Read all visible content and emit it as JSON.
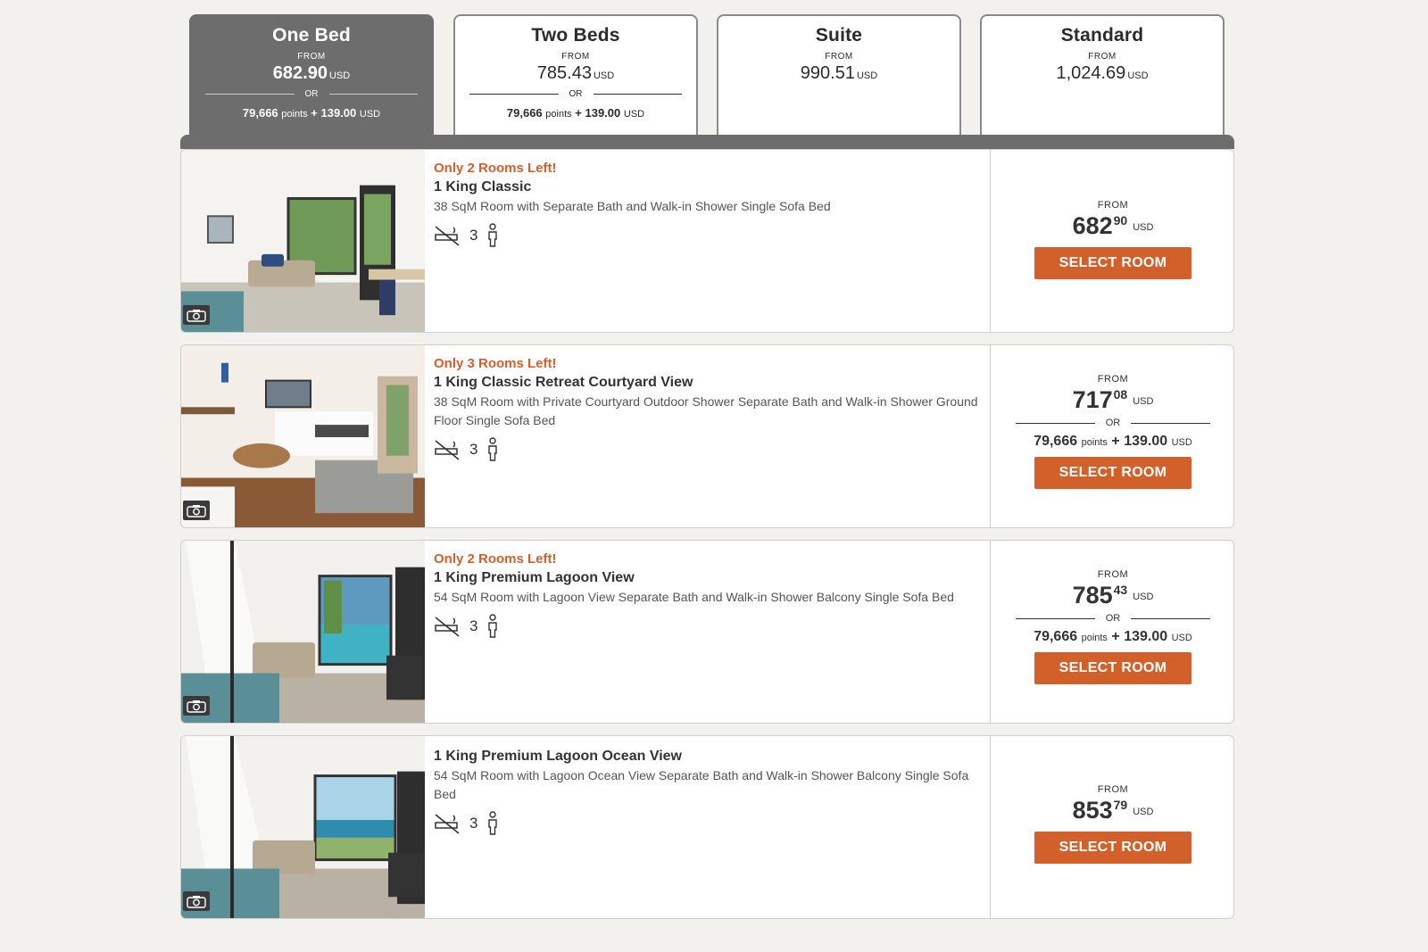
{
  "tabs": [
    {
      "name": "One Bed",
      "from": "FROM",
      "price": "682.90",
      "currency": "USD",
      "or": "OR",
      "points": "79,666",
      "points_word": "points",
      "plus": "+",
      "cash": "139.00",
      "cash_currency": "USD",
      "active": true
    },
    {
      "name": "Two Beds",
      "from": "FROM",
      "price": "785.43",
      "currency": "USD",
      "or": "OR",
      "points": "79,666",
      "points_word": "points",
      "plus": "+",
      "cash": "139.00",
      "cash_currency": "USD",
      "active": false
    },
    {
      "name": "Suite",
      "from": "FROM",
      "price": "990.51",
      "currency": "USD",
      "active": false
    },
    {
      "name": "Standard",
      "from": "FROM",
      "price": "1,024.69",
      "currency": "USD",
      "active": false
    }
  ],
  "rooms": [
    {
      "badge": "Only 2 Rooms Left!",
      "name": "1 King Classic",
      "description": "38 SqM Room with Separate Bath and Walk-in Shower Single Sofa Bed",
      "occupancy": "3",
      "from": "FROM",
      "price_whole": "682",
      "price_cents": "90",
      "currency": "USD",
      "button": "SELECT ROOM"
    },
    {
      "badge": "Only 3 Rooms Left!",
      "name": "1 King Classic Retreat Courtyard View",
      "description": "38 SqM Room with Private Courtyard Outdoor Shower Separate Bath and Walk-in Shower Ground Floor Single Sofa Bed",
      "occupancy": "3",
      "from": "FROM",
      "price_whole": "717",
      "price_cents": "08",
      "currency": "USD",
      "or": "OR",
      "points": "79,666",
      "points_word": "points",
      "plus": "+",
      "cash": "139.00",
      "cash_currency": "USD",
      "button": "SELECT ROOM"
    },
    {
      "badge": "Only 2 Rooms Left!",
      "name": "1 King Premium Lagoon View",
      "description": "54 SqM Room with Lagoon View Separate Bath and Walk-in Shower Balcony Single Sofa Bed",
      "occupancy": "3",
      "from": "FROM",
      "price_whole": "785",
      "price_cents": "43",
      "currency": "USD",
      "or": "OR",
      "points": "79,666",
      "points_word": "points",
      "plus": "+",
      "cash": "139.00",
      "cash_currency": "USD",
      "button": "SELECT ROOM"
    },
    {
      "name": "1 King Premium Lagoon Ocean View",
      "description": "54 SqM Room with Lagoon Ocean View Separate Bath and Walk-in Shower Balcony Single Sofa Bed",
      "occupancy": "3",
      "from": "FROM",
      "price_whole": "853",
      "price_cents": "79",
      "currency": "USD",
      "button": "SELECT ROOM"
    }
  ],
  "icons": {
    "non_smoking": "no-smoking-icon",
    "guests": "person-icon",
    "gallery": "camera-icon"
  },
  "colors": {
    "accent": "#d2602a",
    "tab_active": "#6d6d6d"
  }
}
